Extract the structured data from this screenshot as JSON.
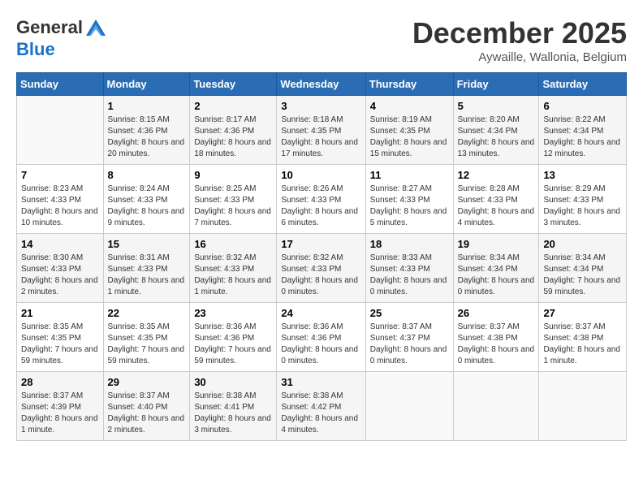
{
  "header": {
    "logo_general": "General",
    "logo_blue": "Blue",
    "month_title": "December 2025",
    "location": "Aywaille, Wallonia, Belgium"
  },
  "weekdays": [
    "Sunday",
    "Monday",
    "Tuesday",
    "Wednesday",
    "Thursday",
    "Friday",
    "Saturday"
  ],
  "weeks": [
    [
      {
        "day": "",
        "info": ""
      },
      {
        "day": "1",
        "info": "Sunrise: 8:15 AM\nSunset: 4:36 PM\nDaylight: 8 hours\nand 20 minutes."
      },
      {
        "day": "2",
        "info": "Sunrise: 8:17 AM\nSunset: 4:36 PM\nDaylight: 8 hours\nand 18 minutes."
      },
      {
        "day": "3",
        "info": "Sunrise: 8:18 AM\nSunset: 4:35 PM\nDaylight: 8 hours\nand 17 minutes."
      },
      {
        "day": "4",
        "info": "Sunrise: 8:19 AM\nSunset: 4:35 PM\nDaylight: 8 hours\nand 15 minutes."
      },
      {
        "day": "5",
        "info": "Sunrise: 8:20 AM\nSunset: 4:34 PM\nDaylight: 8 hours\nand 13 minutes."
      },
      {
        "day": "6",
        "info": "Sunrise: 8:22 AM\nSunset: 4:34 PM\nDaylight: 8 hours\nand 12 minutes."
      }
    ],
    [
      {
        "day": "7",
        "info": "Sunrise: 8:23 AM\nSunset: 4:33 PM\nDaylight: 8 hours\nand 10 minutes."
      },
      {
        "day": "8",
        "info": "Sunrise: 8:24 AM\nSunset: 4:33 PM\nDaylight: 8 hours\nand 9 minutes."
      },
      {
        "day": "9",
        "info": "Sunrise: 8:25 AM\nSunset: 4:33 PM\nDaylight: 8 hours\nand 7 minutes."
      },
      {
        "day": "10",
        "info": "Sunrise: 8:26 AM\nSunset: 4:33 PM\nDaylight: 8 hours\nand 6 minutes."
      },
      {
        "day": "11",
        "info": "Sunrise: 8:27 AM\nSunset: 4:33 PM\nDaylight: 8 hours\nand 5 minutes."
      },
      {
        "day": "12",
        "info": "Sunrise: 8:28 AM\nSunset: 4:33 PM\nDaylight: 8 hours\nand 4 minutes."
      },
      {
        "day": "13",
        "info": "Sunrise: 8:29 AM\nSunset: 4:33 PM\nDaylight: 8 hours\nand 3 minutes."
      }
    ],
    [
      {
        "day": "14",
        "info": "Sunrise: 8:30 AM\nSunset: 4:33 PM\nDaylight: 8 hours\nand 2 minutes."
      },
      {
        "day": "15",
        "info": "Sunrise: 8:31 AM\nSunset: 4:33 PM\nDaylight: 8 hours\nand 1 minute."
      },
      {
        "day": "16",
        "info": "Sunrise: 8:32 AM\nSunset: 4:33 PM\nDaylight: 8 hours\nand 1 minute."
      },
      {
        "day": "17",
        "info": "Sunrise: 8:32 AM\nSunset: 4:33 PM\nDaylight: 8 hours\nand 0 minutes."
      },
      {
        "day": "18",
        "info": "Sunrise: 8:33 AM\nSunset: 4:33 PM\nDaylight: 8 hours\nand 0 minutes."
      },
      {
        "day": "19",
        "info": "Sunrise: 8:34 AM\nSunset: 4:34 PM\nDaylight: 8 hours\nand 0 minutes."
      },
      {
        "day": "20",
        "info": "Sunrise: 8:34 AM\nSunset: 4:34 PM\nDaylight: 7 hours\nand 59 minutes."
      }
    ],
    [
      {
        "day": "21",
        "info": "Sunrise: 8:35 AM\nSunset: 4:35 PM\nDaylight: 7 hours\nand 59 minutes."
      },
      {
        "day": "22",
        "info": "Sunrise: 8:35 AM\nSunset: 4:35 PM\nDaylight: 7 hours\nand 59 minutes."
      },
      {
        "day": "23",
        "info": "Sunrise: 8:36 AM\nSunset: 4:36 PM\nDaylight: 7 hours\nand 59 minutes."
      },
      {
        "day": "24",
        "info": "Sunrise: 8:36 AM\nSunset: 4:36 PM\nDaylight: 8 hours\nand 0 minutes."
      },
      {
        "day": "25",
        "info": "Sunrise: 8:37 AM\nSunset: 4:37 PM\nDaylight: 8 hours\nand 0 minutes."
      },
      {
        "day": "26",
        "info": "Sunrise: 8:37 AM\nSunset: 4:38 PM\nDaylight: 8 hours\nand 0 minutes."
      },
      {
        "day": "27",
        "info": "Sunrise: 8:37 AM\nSunset: 4:38 PM\nDaylight: 8 hours\nand 1 minute."
      }
    ],
    [
      {
        "day": "28",
        "info": "Sunrise: 8:37 AM\nSunset: 4:39 PM\nDaylight: 8 hours\nand 1 minute."
      },
      {
        "day": "29",
        "info": "Sunrise: 8:37 AM\nSunset: 4:40 PM\nDaylight: 8 hours\nand 2 minutes."
      },
      {
        "day": "30",
        "info": "Sunrise: 8:38 AM\nSunset: 4:41 PM\nDaylight: 8 hours\nand 3 minutes."
      },
      {
        "day": "31",
        "info": "Sunrise: 8:38 AM\nSunset: 4:42 PM\nDaylight: 8 hours\nand 4 minutes."
      },
      {
        "day": "",
        "info": ""
      },
      {
        "day": "",
        "info": ""
      },
      {
        "day": "",
        "info": ""
      }
    ]
  ]
}
